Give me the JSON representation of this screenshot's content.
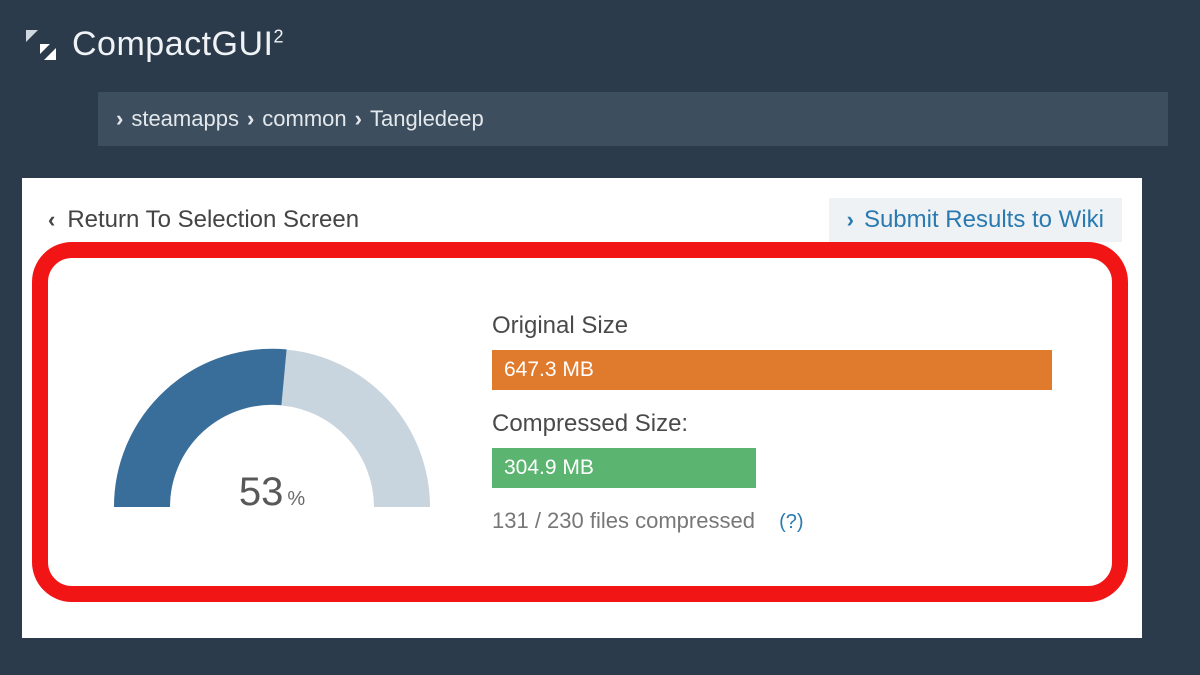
{
  "app": {
    "title": "CompactGUI²"
  },
  "breadcrumb": {
    "items": [
      "steamapps",
      "common",
      "Tangledeep"
    ]
  },
  "links": {
    "back": "Return To Selection Screen",
    "submit": "Submit Results to Wiki"
  },
  "gauge": {
    "percent": "53",
    "unit": "%"
  },
  "stats": {
    "original_label": "Original Size",
    "original_value": "647.3 MB",
    "compressed_label": "Compressed Size:",
    "compressed_value": "304.9 MB",
    "files_line": "131 / 230 files compressed",
    "help": "(?)"
  },
  "colors": {
    "accent_blue": "#2a7ab0",
    "gauge_fill": "#3a6e9a",
    "gauge_track": "#c9d5de",
    "bar_orange": "#e07b2e",
    "bar_green": "#5bb46f",
    "highlight_red": "#f11515"
  },
  "chart_data": {
    "type": "bar",
    "title": "Compression result",
    "categories": [
      "Original Size",
      "Compressed Size"
    ],
    "values": [
      647.3,
      304.9
    ],
    "unit": "MB",
    "compression_percent": 53,
    "files_compressed": 131,
    "files_total": 230
  }
}
